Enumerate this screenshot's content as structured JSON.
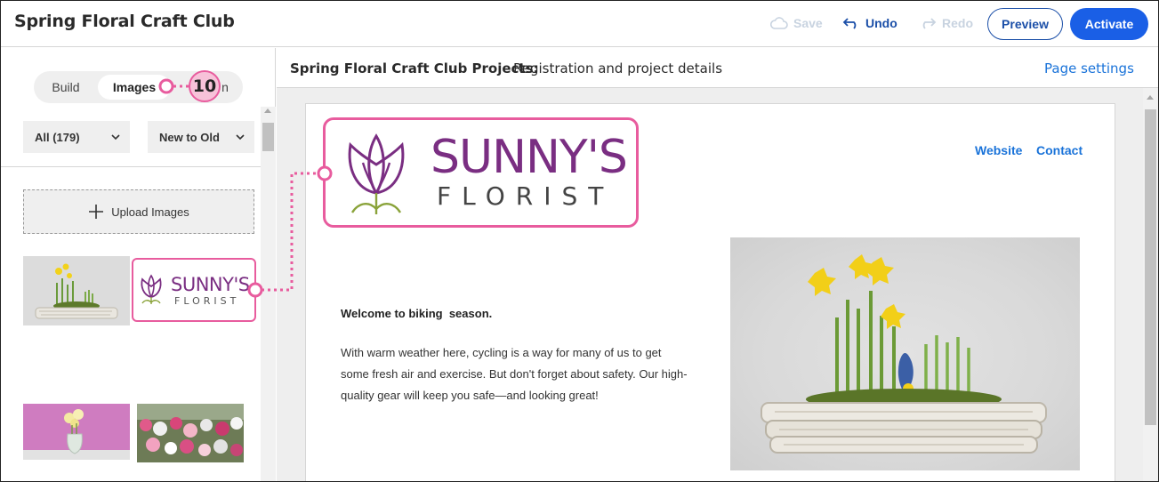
{
  "app": {
    "title": "Spring Floral Craft Club"
  },
  "toolbar": {
    "save_label": "Save",
    "undo_label": "Undo",
    "redo_label": "Redo",
    "preview_label": "Preview",
    "activate_label": "Activate",
    "accent_color": "#1a5fe6"
  },
  "sidebar": {
    "tabs": [
      {
        "label": "Build",
        "active": false
      },
      {
        "label": "Images",
        "active": true
      },
      {
        "label": "n",
        "active": false
      }
    ],
    "filter_dropdown": "All (179)",
    "sort_dropdown": "New to Old",
    "upload_label": "Upload Images",
    "thumbnails": [
      {
        "name": "daffodil-arrangement"
      },
      {
        "name": "sunnys-florist-logo",
        "text_top": "SUNNY'S",
        "text_bottom": "FLORIST",
        "selected": true
      },
      {
        "name": "flowers-in-vase"
      },
      {
        "name": "flower-market"
      }
    ]
  },
  "page_header": {
    "bold": "Spring Floral Craft Club Projects:",
    "normal": "Registration and project details",
    "settings_link": "Page settings"
  },
  "email": {
    "logo": {
      "line1": "SUNNY'S",
      "line2": "FLORIST",
      "brand_color": "#7a2e82"
    },
    "nav": [
      "Website",
      "Contact"
    ],
    "heading": "Welcome to biking  season.",
    "body_lines": [
      "With warm weather here, cycling is a way for many of us to get",
      "some fresh air and exercise. But don't forget about safety. Our high-",
      "quality gear will keep you safe—and looking great!"
    ]
  },
  "callout": {
    "number": "10",
    "color": "#e85c9e"
  }
}
